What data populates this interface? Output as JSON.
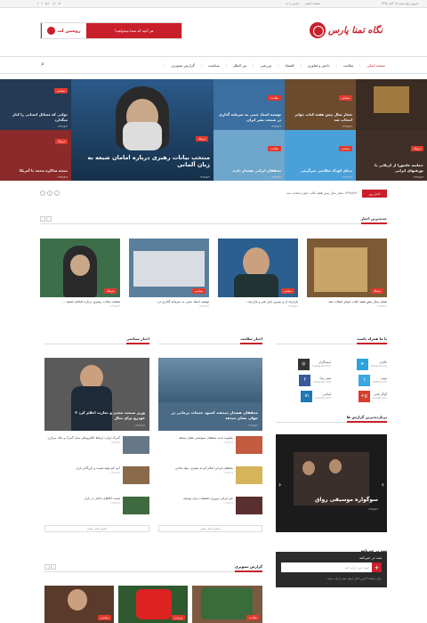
{
  "topbar": {
    "date": "امروز: پنج شنبه ۱۹ آبان ۱۳۹۸",
    "links": [
      "صفحه اصلی",
      "تماس با ما"
    ],
    "social_icons": [
      "twitter-icon",
      "facebook-icon",
      "google-plus-icon",
      "rss-icon",
      "telegram-icon"
    ]
  },
  "header": {
    "logo_text": "نگاه تمنا پارس",
    "banner_text": "هر آنچه که شما میخواهید!",
    "banner_brand": "روشین لب"
  },
  "nav": {
    "items": [
      "صفحه اصلی",
      "سلامت",
      "دانش و فناوری",
      "اقتصاد",
      "ورزشی",
      "بین الملل",
      "سیاست",
      "گزارش تصویری"
    ],
    "active": 0
  },
  "featured": [
    {
      "tag": "فرهنگ",
      "title": "منتخب بیانات رهبری درباره امامان شیعه به زبان آلمانی",
      "date": "۱۳۹۸/۸/۹",
      "color": "#2b5a8a"
    },
    {
      "tag": "سیاسی",
      "title": "شعار سال پیش هفته کتاب جوایز انتخاب شد",
      "date": "۱۳۹۸/۸/۹",
      "color": "#6b4a2e"
    },
    {
      "tag": "سلامت",
      "title": "بازارچه از و بیترین بازار و بازارچه های دولتی ها",
      "date": "۱۳۹۸/۸/۹",
      "color": "#3a6fa0"
    },
    {
      "tag": "سیاسی",
      "title": "توصیه استاد چینی به سرمایه گذاری در صنعت نشر ایران",
      "date": "۱۳۹۸/۸/۹",
      "color": "#2f6ea7"
    },
    {
      "tag": "سیاسی",
      "title": "دولتی که مسائل انسانی را کنار میگذارد",
      "date": "۱۳۹۸/۸/۹",
      "color": "#243a55"
    },
    {
      "tag": "فرهنگ",
      "title": "نتیجه مذاکره محمد با آمریکا",
      "date": "۱۳۹۸/۸/۹",
      "color": "#8a2a2a"
    },
    {
      "tag": "سلامت",
      "title": "محققان ایرانی هشدار دادند",
      "date": "۱۳۹۸/۸/۹",
      "color": "#6fa6cc"
    },
    {
      "tag": "سیاسی",
      "title": "دنیای کودک سلامتی سرگرمی",
      "date": "۱۳۹۸/۸/۹",
      "color": "#4aa0d8"
    },
    {
      "tag": "فرهنگ",
      "title": "حماسه عاشورا از کربلایی با تورفیهای ایرانی",
      "date": "۱۳۹۸/۸/۹",
      "color": "#3f2f28"
    }
  ],
  "ticker": {
    "label": "اخبار روز",
    "text": "۱۳۹۸/۸/۹ شعار سال پیش هفته کتاب جوایز انتخاب شد"
  },
  "latest": {
    "title": "جدیدترین اخبار",
    "items": [
      {
        "title": "شعار سال پیش هفته کتاب جوایز انتخاب شد",
        "date": "۱۳۹۸/۸/۹",
        "tag": "فرهنگ",
        "color": "#7b5a35"
      },
      {
        "title": "بازارچه از و بیترین بازار هنر و بازارچه...",
        "date": "۱۳۹۸/۸/۹",
        "tag": "سیاسی",
        "color": "#2a5f8f"
      },
      {
        "title": "توصیه استاد چینی به سرمایه گذاری در...",
        "date": "۱۳۹۸/۸/۹",
        "tag": "سیاسی",
        "color": "#5a7f9c"
      },
      {
        "title": "منتخب بیانات رهبری درباره امامان شیعه...",
        "date": "۱۳۹۸/۸/۹",
        "tag": "فرهنگ",
        "color": "#3d6e4a"
      }
    ]
  },
  "social": {
    "title": "با ما همراه باشید",
    "items": [
      {
        "name": "تلگرام",
        "handle": "telegram.org",
        "icon": "telegram-icon",
        "color": "#2aa3de"
      },
      {
        "name": "اینستاگرام",
        "handle": "instagram.com",
        "icon": "instagram-icon",
        "color": "#333333"
      },
      {
        "name": "توییتر",
        "handle": "twitter.com",
        "icon": "twitter-icon",
        "color": "#39a7e3"
      },
      {
        "name": "فیس بوک",
        "handle": "facebook.com",
        "icon": "facebook-icon",
        "color": "#395a9a"
      },
      {
        "name": "گوگل پلاس",
        "handle": "google.com",
        "icon": "google-plus-icon",
        "color": "#d4402c"
      },
      {
        "name": "لینکدین",
        "handle": "linkedin.com",
        "icon": "linkedin-icon",
        "color": "#1e79b5"
      }
    ]
  },
  "health": {
    "title": "اخبار سلامت",
    "lead": "محققان هشدار میدهند کمبود خدمات درمانی در جهان نشان میدهد",
    "lead_date": "۱۳۹۸/۸/۹",
    "items": [
      {
        "title": "مقاومه جدید محققان سوئیسی نشان میدهد",
        "date": "۱۳۹۸/۸/۹"
      },
      {
        "title": "محققان ایرانی اعلام کردند مصرف مواد غذایی",
        "date": "۱۳۹۸/۸/۹"
      },
      {
        "title": "خبر ایرانی پیروزی تحقیقات برای توسعه",
        "date": "۱۳۹۸/۸/۹"
      }
    ],
    "more": "نمایش اخبار بیشتر"
  },
  "politics": {
    "title": "اخبار سیاسی",
    "lead": "وزیر صنعت معدن و تجارت اعلام کرد ۲ خودرو برای سال",
    "lead_date": "۱۳۹۸/۸/۹",
    "items": [
      {
        "title": "گمرک ایران: ارتباط الکترونیکی میان گمرک و بانک مرکزی",
        "date": "۱۳۹۸/۸/۹"
      },
      {
        "title": "کره کم تولید قیمت و بازرگانی بازار",
        "date": "۱۳۹۸/۸/۹"
      },
      {
        "title": "قیمت کالاهای داخلی در بازار",
        "date": "۱۳۹۸/۸/۹"
      }
    ],
    "more": "نمایش اخبار بیشتر"
  },
  "popular": {
    "title": "پربازدیدترین گزارش ها",
    "caption": "سوگواره موسیقی رواق",
    "date": "۱۳۹۸/۸/۹"
  },
  "photo": {
    "title": "گزارش تصویری",
    "items": [
      {
        "tag": "سیاسی",
        "color": "#5a3a2a"
      },
      {
        "tag": "ورزشی",
        "color": "#2f5a2f"
      },
      {
        "tag": "سلامت",
        "color": "#7b5a40"
      }
    ]
  },
  "newsletter": {
    "title": "ثبت در خبرنامه",
    "placeholder": "ایمیل خود را وارد کنید",
    "note": "برای دریافت آخرین اخبار ایمیل خود را وارد نمایید"
  }
}
